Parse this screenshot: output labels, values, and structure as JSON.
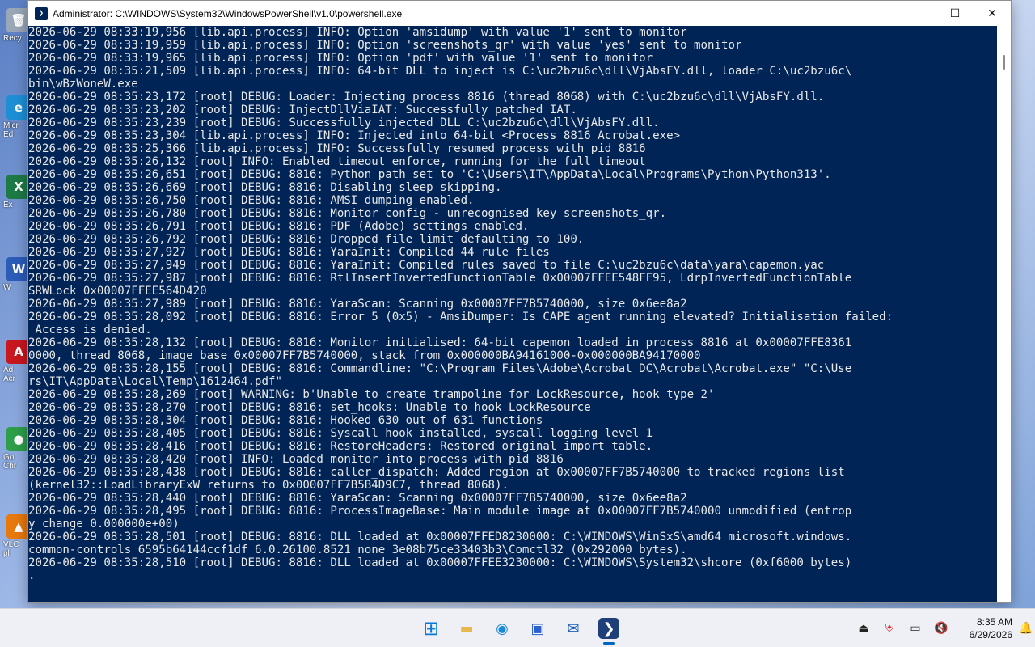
{
  "window": {
    "title": "Administrator: C:\\WINDOWS\\System32\\WindowsPowerShell\\v1.0\\powershell.exe",
    "minimize_glyph": "—",
    "maximize_glyph": "☐",
    "close_glyph": "✕"
  },
  "console": {
    "lines": [
      "2026-06-29 08:33:19,956 [lib.api.process] INFO: Option 'amsidump' with value '1' sent to monitor",
      "2026-06-29 08:33:19,959 [lib.api.process] INFO: Option 'screenshots_qr' with value 'yes' sent to monitor",
      "2026-06-29 08:33:19,965 [lib.api.process] INFO: Option 'pdf' with value '1' sent to monitor",
      "2026-06-29 08:35:21,509 [lib.api.process] INFO: 64-bit DLL to inject is C:\\uc2bzu6c\\dll\\VjAbsFY.dll, loader C:\\uc2bzu6c\\",
      "bin\\wBzWoneW.exe",
      "2026-06-29 08:35:23,172 [root] DEBUG: Loader: Injecting process 8816 (thread 8068) with C:\\uc2bzu6c\\dll\\VjAbsFY.dll.",
      "2026-06-29 08:35:23,202 [root] DEBUG: InjectDllViaIAT: Successfully patched IAT.",
      "2026-06-29 08:35:23,239 [root] DEBUG: Successfully injected DLL C:\\uc2bzu6c\\dll\\VjAbsFY.dll.",
      "2026-06-29 08:35:23,304 [lib.api.process] INFO: Injected into 64-bit <Process 8816 Acrobat.exe>",
      "2026-06-29 08:35:25,366 [lib.api.process] INFO: Successfully resumed process with pid 8816",
      "2026-06-29 08:35:26,132 [root] INFO: Enabled timeout enforce, running for the full timeout",
      "2026-06-29 08:35:26,651 [root] DEBUG: 8816: Python path set to 'C:\\Users\\IT\\AppData\\Local\\Programs\\Python\\Python313'.",
      "2026-06-29 08:35:26,669 [root] DEBUG: 8816: Disabling sleep skipping.",
      "2026-06-29 08:35:26,750 [root] DEBUG: 8816: AMSI dumping enabled.",
      "2026-06-29 08:35:26,780 [root] DEBUG: 8816: Monitor config - unrecognised key screenshots_qr.",
      "2026-06-29 08:35:26,791 [root] DEBUG: 8816: PDF (Adobe) settings enabled.",
      "2026-06-29 08:35:26,792 [root] DEBUG: 8816: Dropped file limit defaulting to 100.",
      "2026-06-29 08:35:27,927 [root] DEBUG: 8816: YaraInit: Compiled 44 rule files",
      "2026-06-29 08:35:27,949 [root] DEBUG: 8816: YaraInit: Compiled rules saved to file C:\\uc2bzu6c\\data\\yara\\capemon.yac",
      "2026-06-29 08:35:27,987 [root] DEBUG: 8816: RtlInsertInvertedFunctionTable 0x00007FFEE548FF95, LdrpInvertedFunctionTable",
      "SRWLock 0x00007FFEE564D420",
      "2026-06-29 08:35:27,989 [root] DEBUG: 8816: YaraScan: Scanning 0x00007FF7B5740000, size 0x6ee8a2",
      "2026-06-29 08:35:28,092 [root] DEBUG: 8816: Error 5 (0x5) - AmsiDumper: Is CAPE agent running elevated? Initialisation failed:",
      " Access is denied.",
      "2026-06-29 08:35:28,132 [root] DEBUG: 8816: Monitor initialised: 64-bit capemon loaded in process 8816 at 0x00007FFE8361",
      "0000, thread 8068, image base 0x00007FF7B5740000, stack from 0x000000BA94161000-0x000000BA94170000",
      "2026-06-29 08:35:28,155 [root] DEBUG: 8816: Commandline: \"C:\\Program Files\\Adobe\\Acrobat DC\\Acrobat\\Acrobat.exe\" \"C:\\Use",
      "rs\\IT\\AppData\\Local\\Temp\\1612464.pdf\"",
      "2026-06-29 08:35:28,269 [root] WARNING: b'Unable to create trampoline for LockResource, hook type 2'",
      "2026-06-29 08:35:28,270 [root] DEBUG: 8816: set_hooks: Unable to hook LockResource",
      "2026-06-29 08:35:28,304 [root] DEBUG: 8816: Hooked 630 out of 631 functions",
      "2026-06-29 08:35:28,405 [root] DEBUG: 8816: Syscall hook installed, syscall logging level 1",
      "2026-06-29 08:35:28,416 [root] DEBUG: 8816: RestoreHeaders: Restored original import table.",
      "2026-06-29 08:35:28,420 [root] INFO: Loaded monitor into process with pid 8816",
      "2026-06-29 08:35:28,438 [root] DEBUG: 8816: caller_dispatch: Added region at 0x00007FF7B5740000 to tracked regions list",
      "(kernel32::LoadLibraryExW returns to 0x00007FF7B5B4D9C7, thread 8068).",
      "2026-06-29 08:35:28,440 [root] DEBUG: 8816: YaraScan: Scanning 0x00007FF7B5740000, size 0x6ee8a2",
      "2026-06-29 08:35:28,495 [root] DEBUG: 8816: ProcessImageBase: Main module image at 0x00007FF7B5740000 unmodified (entrop",
      "y change 0.000000e+00)",
      "2026-06-29 08:35:28,501 [root] DEBUG: 8816: DLL loaded at 0x00007FFED8230000: C:\\WINDOWS\\WinSxS\\amd64_microsoft.windows.",
      "common-controls_6595b64144ccf1df_6.0.26100.8521_none_3e08b75ce33403b3\\Comctl32 (0x292000 bytes).",
      "2026-06-29 08:35:28,510 [root] DEBUG: 8816: DLL loaded at 0x00007FFEE3230000: C:\\WINDOWS\\System32\\shcore (0xf6000 bytes)",
      "."
    ]
  },
  "desktop_icons": [
    {
      "name": "recycle-bin-icon",
      "glyph": "🗑",
      "label": "Recy",
      "color": "#9aa7b8"
    },
    {
      "name": "edge-shortcut-icon",
      "glyph": "e",
      "label": "Micr\nEd",
      "color": "#1e8fd6"
    },
    {
      "name": "excel-shortcut-icon",
      "glyph": "X",
      "label": "Ex",
      "color": "#1d7a45"
    },
    {
      "name": "word-shortcut-icon",
      "glyph": "W",
      "label": "W",
      "color": "#2b5cb8"
    },
    {
      "name": "acrobat-shortcut-icon",
      "glyph": "A",
      "label": "Ad\nAcr",
      "color": "#c8171e"
    },
    {
      "name": "chrome-shortcut-icon",
      "glyph": "●",
      "label": "Go\nChr",
      "color": "#2e9e4a"
    },
    {
      "name": "vlc-shortcut-icon",
      "glyph": "▲",
      "label": "VLC\npl",
      "color": "#e8790c"
    }
  ],
  "taskbar": {
    "apps": [
      {
        "name": "start-button",
        "glyph": "⊞",
        "color": "#0a78d4",
        "bg": "transparent"
      },
      {
        "name": "file-explorer-button",
        "glyph": "▬",
        "color": "#e8b84a",
        "bg": "transparent"
      },
      {
        "name": "edge-button",
        "glyph": "◉",
        "color": "#1a8ad8",
        "bg": "transparent"
      },
      {
        "name": "store-button",
        "glyph": "▣",
        "color": "#2a5fd0",
        "bg": "transparent"
      },
      {
        "name": "outlook-button",
        "glyph": "✉",
        "color": "#1d5fb8",
        "bg": "transparent"
      },
      {
        "name": "powershell-button",
        "glyph": "❯",
        "color": "#ffffff",
        "bg": "#1f3f78"
      }
    ],
    "tray": {
      "usb_glyph": "⏏",
      "security_glyph": "⛨",
      "network_glyph": "▭",
      "volume_glyph": "🔇",
      "notification_glyph": "🔔",
      "time": "8:35 AM",
      "date": "6/29/2026"
    }
  }
}
